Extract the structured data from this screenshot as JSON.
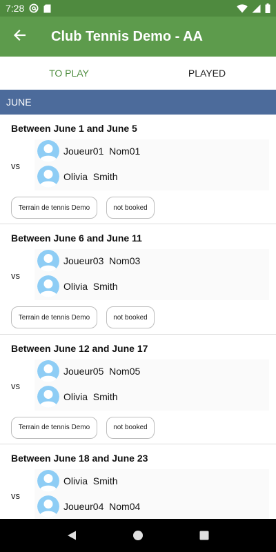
{
  "status_bar": {
    "time": "7:28",
    "left_icons": [
      "at-sign-icon",
      "sd-card-icon"
    ],
    "right_icons": [
      "wifi-icon",
      "signal-icon",
      "battery-icon"
    ]
  },
  "app_bar": {
    "back_icon": "arrow-left-icon",
    "title": "Club Tennis Demo - AA"
  },
  "tabs": [
    {
      "label": "TO PLAY",
      "active": true
    },
    {
      "label": "PLAYED",
      "active": false
    }
  ],
  "month": {
    "label": "JUNE"
  },
  "matches": [
    {
      "title": "Between June 1 and June 5",
      "vs_label": "vs",
      "players": [
        {
          "name": "Joueur01  Nom01"
        },
        {
          "name": "Olivia  Smith"
        }
      ],
      "court": "Terrain de tennis Demo",
      "booking": "not booked"
    },
    {
      "title": "Between June 6 and June 11",
      "vs_label": "vs",
      "players": [
        {
          "name": "Joueur03  Nom03"
        },
        {
          "name": "Olivia  Smith"
        }
      ],
      "court": "Terrain de tennis Demo",
      "booking": "not booked"
    },
    {
      "title": "Between June 12 and June 17",
      "vs_label": "vs",
      "players": [
        {
          "name": "Joueur05  Nom05"
        },
        {
          "name": "Olivia  Smith"
        }
      ],
      "court": "Terrain de tennis Demo",
      "booking": "not booked"
    },
    {
      "title": "Between June 18 and June 23",
      "vs_label": "vs",
      "players": [
        {
          "name": "Olivia  Smith"
        },
        {
          "name": "Joueur04  Nom04"
        }
      ],
      "court": "",
      "booking": ""
    }
  ],
  "nav_bar": {
    "buttons": [
      "back-triangle-icon",
      "home-circle-icon",
      "recents-square-icon"
    ]
  },
  "colors": {
    "status_bar": "#4f8a3f",
    "app_bar": "#5d9b4c",
    "tab_active_text": "#4e8d3f",
    "month_header": "#4c6b9b",
    "avatar_fill": "#8ecdf5"
  }
}
